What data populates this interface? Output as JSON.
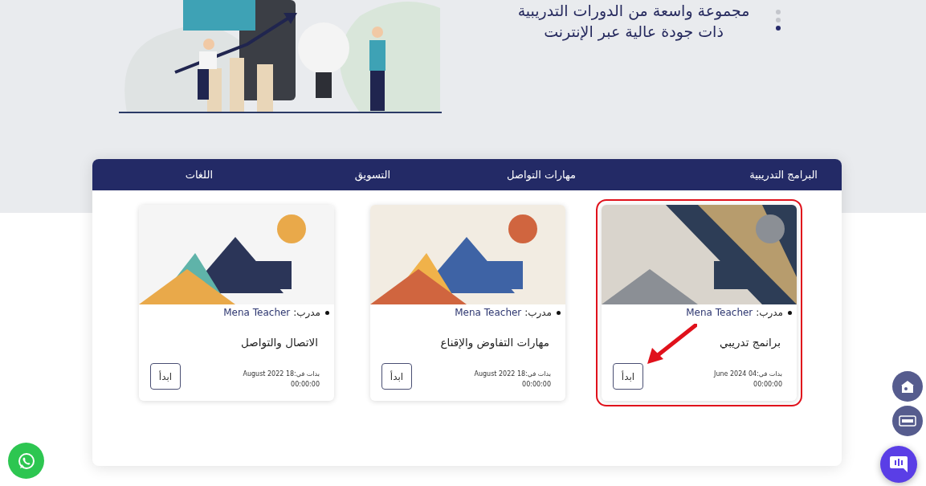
{
  "hero": {
    "lines": [
      "مجموعة واسعة من الدورات التدريبية",
      "ذات جودة عالية عبر الإنترنت"
    ],
    "slides": [
      {
        "selected": false
      },
      {
        "selected": false
      },
      {
        "selected": true
      }
    ]
  },
  "tabs": [
    {
      "label": "البرامج التدريبية"
    },
    {
      "label": "مهارات التواصل"
    },
    {
      "label": "التسويق"
    },
    {
      "label": "اللغات"
    }
  ],
  "courses": [
    {
      "trainer_label": "مدرب:",
      "trainer": "Mena Teacher",
      "title": "برانمج تدريبي",
      "started": "بدات في:04 June 2024",
      "time": "00:00:00",
      "button": "ابدأ",
      "highlighted": true
    },
    {
      "trainer_label": "مدرب:",
      "trainer": "Mena Teacher",
      "title": "مهارات التفاوض والإقناع",
      "started": "بدات في:18 August 2022",
      "time": "00:00:00",
      "button": "ابدأ",
      "highlighted": false
    },
    {
      "trainer_label": "مدرب:",
      "trainer": "Mena Teacher",
      "title": "الاتصال والتواصل",
      "started": "بدات في:18 August 2022",
      "time": "00:00:00",
      "button": "ابدأ",
      "highlighted": false
    }
  ]
}
